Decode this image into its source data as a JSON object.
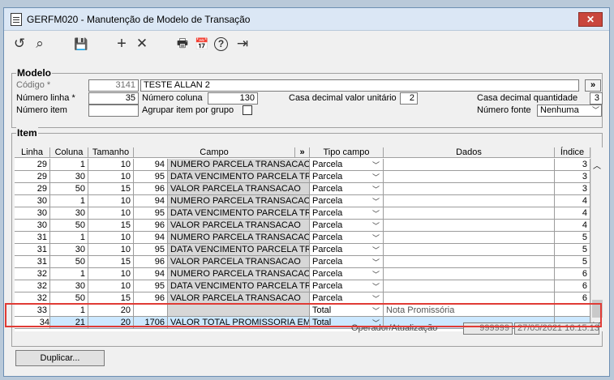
{
  "window": {
    "title": "GERFM020 - Manutenção de Modelo de Transação",
    "close_symbol": "✕"
  },
  "toolbar": {
    "undo_icon": "↺",
    "search_icon": "⌕",
    "save_icon": "💾",
    "add_icon": "+",
    "delete_icon": "✕",
    "print_icon": "🖶",
    "calendar_icon": "📅",
    "help_icon": "?",
    "exit_icon": "⇥"
  },
  "modelo": {
    "section_label": "Modelo",
    "codigo_label": "Código *",
    "codigo_value": "3141",
    "descricao_value": "TESTE ALLAN 2",
    "expand_button": "»",
    "numero_linha_label": "Número linha *",
    "numero_linha_value": "35",
    "numero_coluna_label": "Número coluna",
    "numero_coluna_value": "130",
    "casa_decimal_valor_label": "Casa decimal valor unitário",
    "casa_decimal_valor_value": "2",
    "casa_decimal_qtd_label": "Casa decimal quantidade",
    "casa_decimal_qtd_value": "3",
    "numero_item_label": "Número item",
    "numero_item_value": "",
    "agrupar_label": "Agrupar item por grupo",
    "numero_fonte_label": "Número fonte",
    "numero_fonte_value": "Nenhuma"
  },
  "item": {
    "section_label": "Item",
    "columns": {
      "linha": "Linha",
      "coluna": "Coluna",
      "tamanho": "Tamanho",
      "campo": "Campo",
      "expand": "»",
      "tipo_campo": "Tipo campo",
      "dados": "Dados",
      "indice": "Índice"
    },
    "rows": [
      {
        "linha": "29",
        "coluna": "1",
        "tamanho": "10",
        "code": "94",
        "campo": "NUMERO PARCELA TRANSACAO",
        "tipo": "Parcela",
        "dados": "",
        "indice": "3"
      },
      {
        "linha": "29",
        "coluna": "30",
        "tamanho": "10",
        "code": "95",
        "campo": "DATA VENCIMENTO PARCELA TRAN",
        "tipo": "Parcela",
        "dados": "",
        "indice": "3"
      },
      {
        "linha": "29",
        "coluna": "50",
        "tamanho": "15",
        "code": "96",
        "campo": "VALOR PARCELA TRANSACAO",
        "tipo": "Parcela",
        "dados": "",
        "indice": "3"
      },
      {
        "linha": "30",
        "coluna": "1",
        "tamanho": "10",
        "code": "94",
        "campo": "NUMERO PARCELA TRANSACAO",
        "tipo": "Parcela",
        "dados": "",
        "indice": "4"
      },
      {
        "linha": "30",
        "coluna": "30",
        "tamanho": "10",
        "code": "95",
        "campo": "DATA VENCIMENTO PARCELA TRAN",
        "tipo": "Parcela",
        "dados": "",
        "indice": "4"
      },
      {
        "linha": "30",
        "coluna": "50",
        "tamanho": "15",
        "code": "96",
        "campo": "VALOR PARCELA TRANSACAO",
        "tipo": "Parcela",
        "dados": "",
        "indice": "4"
      },
      {
        "linha": "31",
        "coluna": "1",
        "tamanho": "10",
        "code": "94",
        "campo": "NUMERO PARCELA TRANSACAO",
        "tipo": "Parcela",
        "dados": "",
        "indice": "5"
      },
      {
        "linha": "31",
        "coluna": "30",
        "tamanho": "10",
        "code": "95",
        "campo": "DATA VENCIMENTO PARCELA TRAN",
        "tipo": "Parcela",
        "dados": "",
        "indice": "5"
      },
      {
        "linha": "31",
        "coluna": "50",
        "tamanho": "15",
        "code": "96",
        "campo": "VALOR PARCELA TRANSACAO",
        "tipo": "Parcela",
        "dados": "",
        "indice": "5"
      },
      {
        "linha": "32",
        "coluna": "1",
        "tamanho": "10",
        "code": "94",
        "campo": "NUMERO PARCELA TRANSACAO",
        "tipo": "Parcela",
        "dados": "",
        "indice": "6"
      },
      {
        "linha": "32",
        "coluna": "30",
        "tamanho": "10",
        "code": "95",
        "campo": "DATA VENCIMENTO PARCELA TRAN",
        "tipo": "Parcela",
        "dados": "",
        "indice": "6"
      },
      {
        "linha": "32",
        "coluna": "50",
        "tamanho": "15",
        "code": "96",
        "campo": "VALOR PARCELA TRANSACAO",
        "tipo": "Parcela",
        "dados": "",
        "indice": "6"
      },
      {
        "linha": "33",
        "coluna": "1",
        "tamanho": "20",
        "code": "",
        "campo": "",
        "tipo": "Total",
        "dados": "Nota Promissória",
        "indice": ""
      },
      {
        "linha": "34",
        "coluna": "21",
        "tamanho": "20",
        "code": "1706",
        "campo": "VALOR TOTAL PROMISSORIA EM A",
        "tipo": "Total",
        "dados": "",
        "indice": ""
      }
    ]
  },
  "footer": {
    "operador_label": "Operador/Atualização",
    "operador_value": "999999",
    "atualizacao_value": "27/05/2021 16:15:13",
    "duplicar_button": "Duplicar..."
  },
  "colors": {
    "selected_row": "#cce8ff",
    "highlight_border": "#e03b35",
    "title_bar": "#dbe7f5"
  }
}
